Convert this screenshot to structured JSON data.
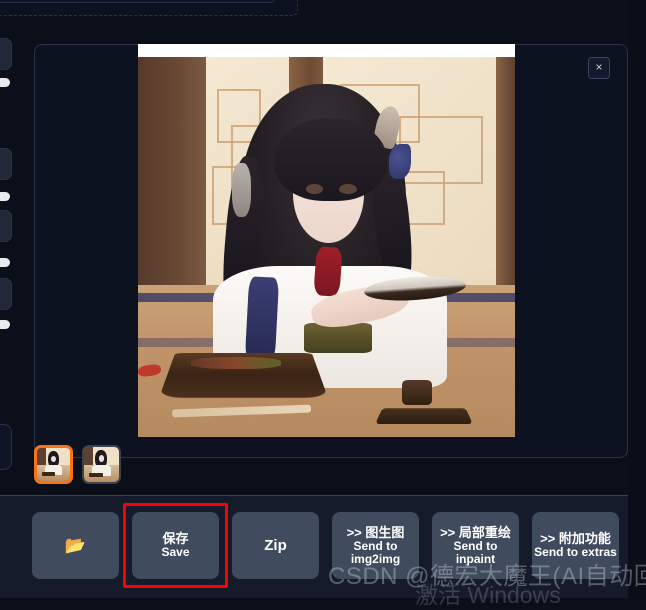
{
  "app": {
    "theme_bg": "#0b0f19",
    "panel_bg": "#0d1220",
    "button_bg": "#414b5e",
    "accent_orange": "#f97316",
    "highlight_red": "#ff0000"
  },
  "result_panel": {
    "close_label": "×",
    "close_icon": "close-icon"
  },
  "gallery": {
    "thumbnails": [
      {
        "alt": "generated-image-1",
        "selected": true
      },
      {
        "alt": "generated-image-2",
        "selected": false
      }
    ]
  },
  "actions": [
    {
      "name": "open-folder",
      "icon": "folder-icon",
      "glyph": "📂",
      "cn": "",
      "en": ""
    },
    {
      "name": "save",
      "icon": "",
      "glyph": "",
      "cn": "保存",
      "en": "Save",
      "highlighted": true
    },
    {
      "name": "zip",
      "icon": "",
      "glyph": "",
      "cn": "",
      "en": "Zip",
      "big": true
    },
    {
      "name": "send-to-img2img",
      "icon": "",
      "glyph": "",
      "cn": ">> 图生图",
      "en": "Send to img2img"
    },
    {
      "name": "send-to-inpaint",
      "icon": "",
      "glyph": "",
      "cn": ">> 局部重绘",
      "en": "Send to inpaint"
    },
    {
      "name": "send-to-extras",
      "icon": "",
      "glyph": "",
      "cn": ">> 附加功能",
      "en": "Send to extras"
    }
  ],
  "watermarks": {
    "csdn": "CSDN @德宏大魔王(AI自动回关)",
    "windows": "激活 Windows"
  }
}
